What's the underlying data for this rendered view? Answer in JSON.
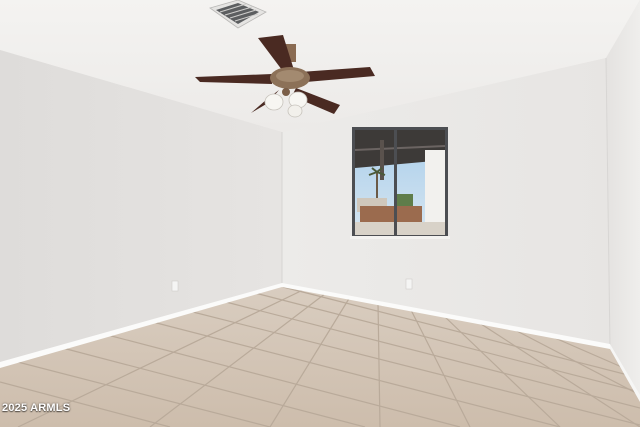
{
  "photo": {
    "subject": "empty-room",
    "watermark": "2025 ARMLS",
    "colors": {
      "ceiling": "#f0efed",
      "left_wall": "#e3e1df",
      "back_wall": "#eae8e6",
      "right_wall": "#e8e6e4",
      "floor_tile": "#d2c4b5",
      "grout": "#b7a797",
      "baseboard": "#fbfbfa",
      "fan_blade": "#4a2a22",
      "window_frame": "#4c4e52"
    }
  }
}
